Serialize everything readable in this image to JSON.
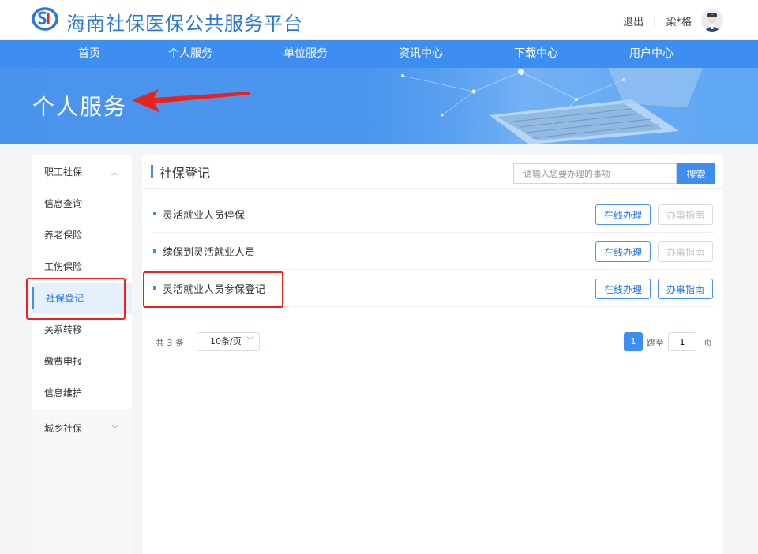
{
  "header": {
    "site_title": "海南社保医保公共服务平台",
    "logout_label": "退出",
    "separator": "|",
    "username": "梁*格"
  },
  "nav": {
    "items": [
      "首页",
      "个人服务",
      "单位服务",
      "资讯中心",
      "下载中心",
      "用户中心"
    ]
  },
  "banner": {
    "title": "个人服务"
  },
  "sidebar": {
    "group1": {
      "label": "职工社保",
      "chevron": "^"
    },
    "items": [
      {
        "label": "信息查询"
      },
      {
        "label": "养老保险"
      },
      {
        "label": "工伤保险"
      },
      {
        "label": "社保登记",
        "active": true
      },
      {
        "label": "关系转移"
      },
      {
        "label": "缴费申报"
      },
      {
        "label": "信息维护"
      }
    ],
    "group2": {
      "label": "城乡社保",
      "chevron": "v"
    }
  },
  "main": {
    "title": "社保登记",
    "search_placeholder": "请输入您要办理的事项",
    "search_button": "搜索",
    "rows": [
      {
        "label": "灵活就业人员停保",
        "online_label": "在线办理",
        "guide_label": "办事指南",
        "guide_enabled": false
      },
      {
        "label": "续保到灵活就业人员",
        "online_label": "在线办理",
        "guide_label": "办事指南",
        "guide_enabled": false
      },
      {
        "label": "灵活就业人员参保登记",
        "online_label": "在线办理",
        "guide_label": "办事指南",
        "guide_enabled": true
      }
    ],
    "pager": {
      "total": "共 3 条",
      "page_size": "10条/页",
      "current_page": "1",
      "jump_label": "跳至",
      "jump_value": "1",
      "suffix": "页"
    }
  },
  "colors": {
    "primary": "#3d8ef0",
    "title_blue": "#2a78d8",
    "annotation_red": "#e8231e"
  }
}
